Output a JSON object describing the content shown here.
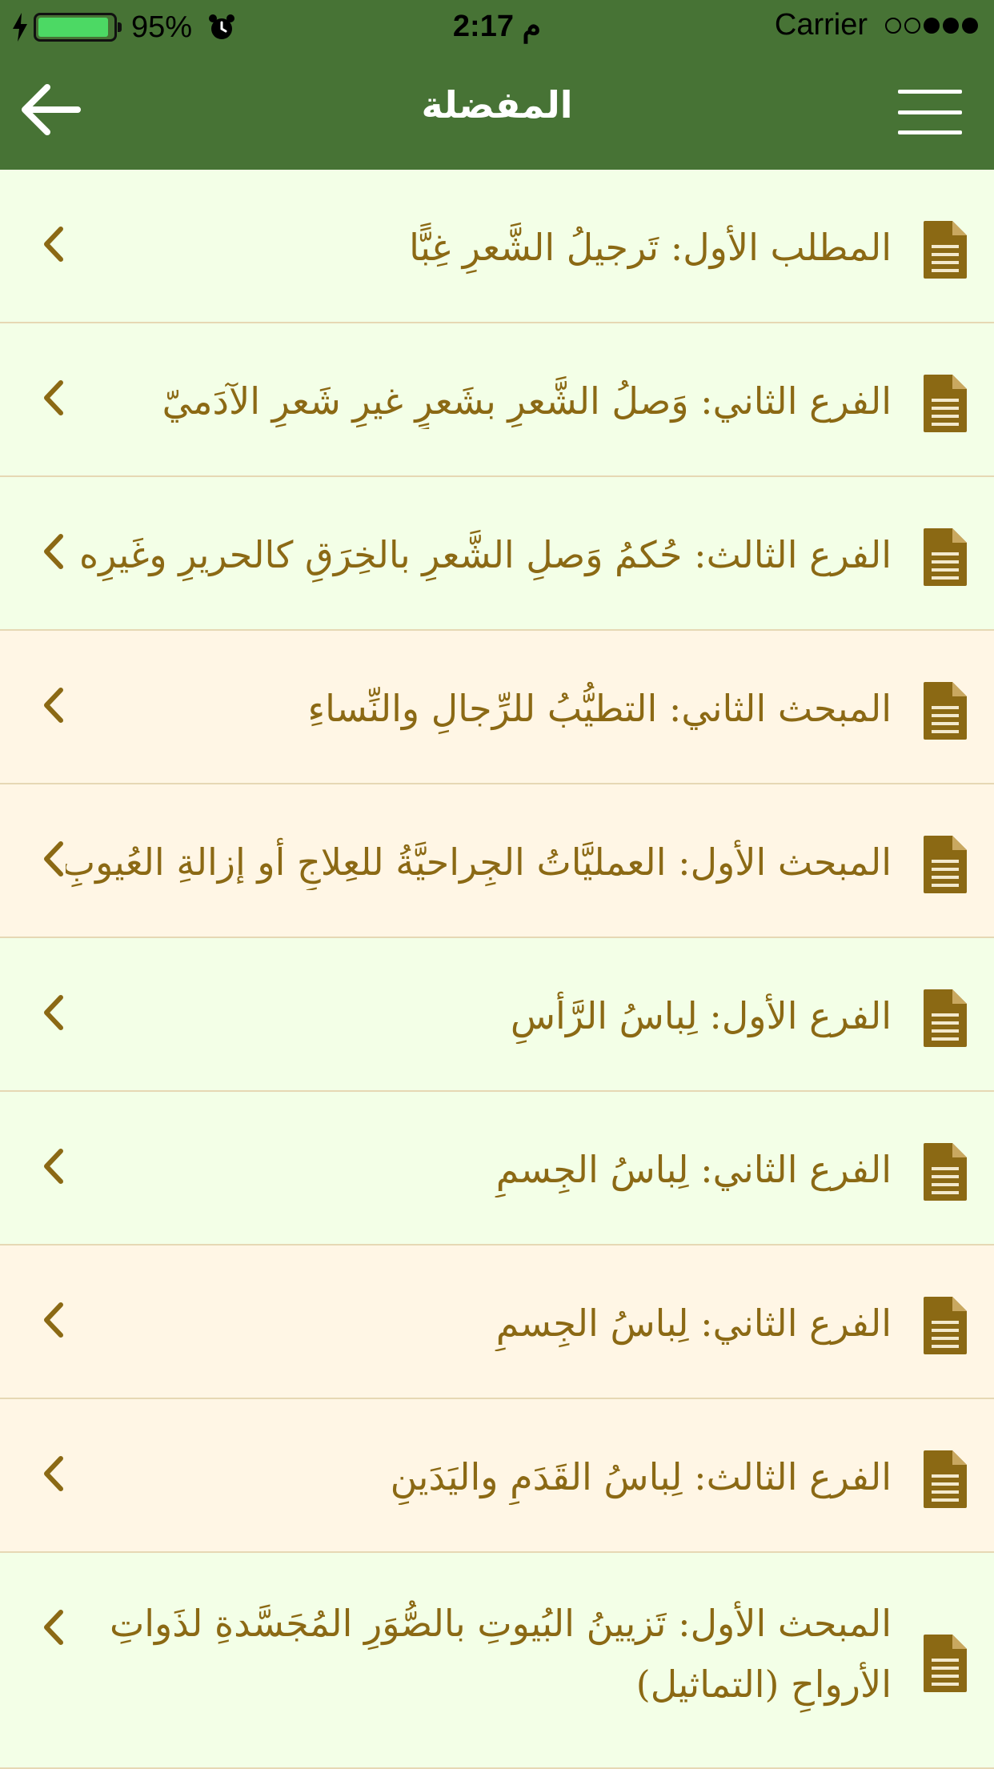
{
  "status_bar": {
    "battery_percent": "95%",
    "time": "2:17 م",
    "carrier": "Carrier",
    "battery_level": 0.95,
    "colors": {
      "battery_fill": "#4CD964"
    }
  },
  "nav": {
    "title": "المفضلة",
    "back_icon": "back-arrow-icon",
    "menu_icon": "hamburger-menu-icon",
    "background": "#477335"
  },
  "list": {
    "items": [
      {
        "title": "المطلب الأول: تَرجيلُ الشَّعرِ غِبًّا",
        "bg": "#F3FFE7"
      },
      {
        "title": "الفرع الثاني: وَصلُ الشَّعرِ بشَعرٍ غيرِ شَعرِ الآدَميّ",
        "bg": "#F3FFE7"
      },
      {
        "title": "الفرع الثالث: حُكمُ وَصلِ الشَّعرِ بالخِرَقِ كالحريرِ وغَيرِه",
        "bg": "#F3FFE7"
      },
      {
        "title": "المبحث الثاني: التطيُّبُ للرِّجالِ والنِّساءِ",
        "bg": "#FFF6E5"
      },
      {
        "title": "المبحث الأول: العمليَّاتُ الجِراحيَّةُ للعِلاجِ أو إزالةِ العُيوبِ",
        "bg": "#FFF6E5"
      },
      {
        "title": "الفرع الأول: لِباسُ الرَّأسِ",
        "bg": "#F3FFE7"
      },
      {
        "title": "الفرع الثاني: لِباسُ الجِسمِ",
        "bg": "#F3FFE7"
      },
      {
        "title": "الفرع الثاني: لِباسُ الجِسمِ",
        "bg": "#FFF6E5"
      },
      {
        "title": "الفرع الثالث: لِباسُ القَدَمِ واليَدَينِ",
        "bg": "#FFF6E5"
      },
      {
        "title": "المبحث الأول: تَزيينُ البُيوتِ بالصُّوَرِ المُجَسَّدةِ لذَواتِ الأرواحِ (التماثيل)",
        "bg": "#F3FFE7"
      }
    ],
    "item_icon": "document-icon",
    "chevron_icon": "chevron-left-icon",
    "text_color": "#8B6914",
    "icon_color": "#8B6914"
  }
}
